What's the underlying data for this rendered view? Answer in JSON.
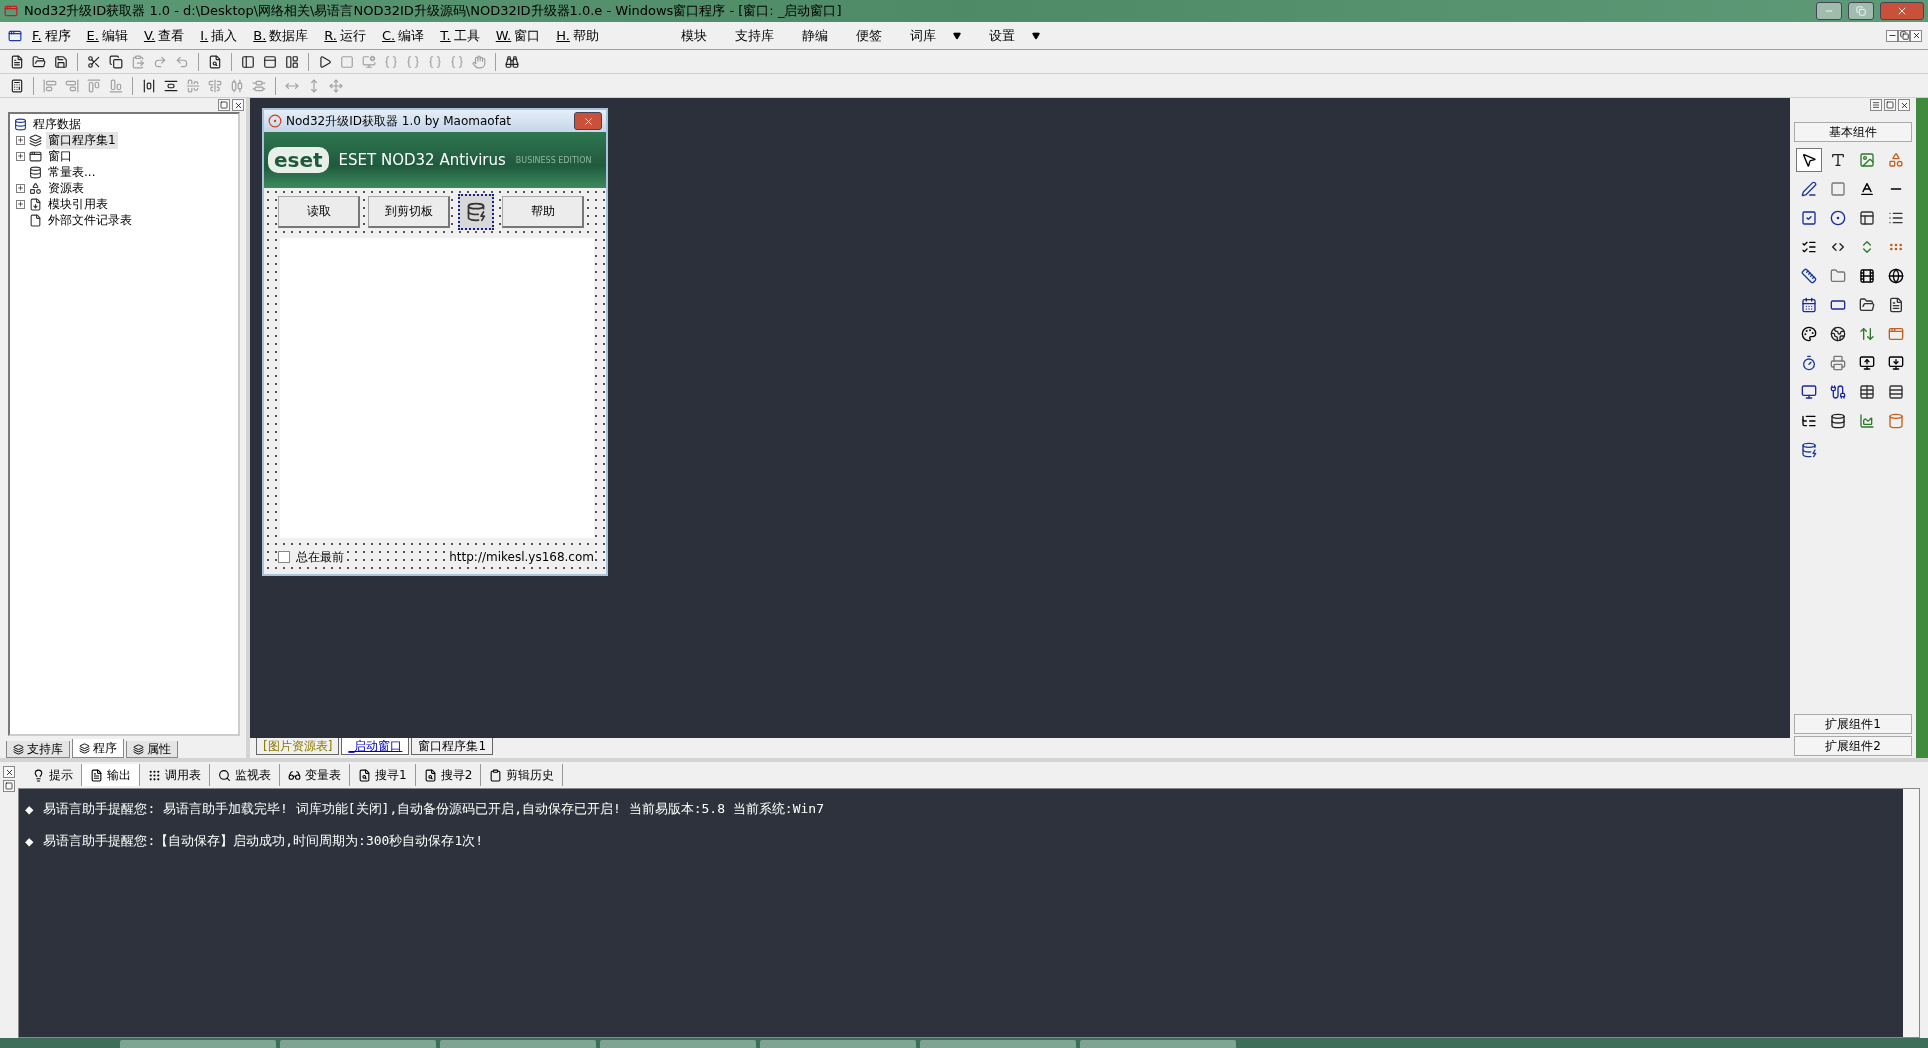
{
  "window": {
    "title": "Nod32升级ID获取器 1.0 - d:\\Desktop\\网络相关\\易语言NOD32ID升级源码\\NOD32ID升级器1.0.e - Windows窗口程序 - [窗口: _启动窗口]"
  },
  "menu": [
    {
      "key": "F.",
      "label": "程序"
    },
    {
      "key": "E.",
      "label": "编辑"
    },
    {
      "key": "V.",
      "label": "查看"
    },
    {
      "key": "I.",
      "label": "插入"
    },
    {
      "key": "B.",
      "label": "数据库"
    },
    {
      "key": "R.",
      "label": "运行"
    },
    {
      "key": "C.",
      "label": "编译"
    },
    {
      "key": "T.",
      "label": "工具"
    },
    {
      "key": "W.",
      "label": "窗口"
    },
    {
      "key": "H.",
      "label": "帮助"
    }
  ],
  "quick_menu": [
    {
      "label": "模块",
      "dropdown": false
    },
    {
      "label": "支持库",
      "dropdown": false
    },
    {
      "label": "静编",
      "dropdown": false
    },
    {
      "label": "便签",
      "dropdown": false
    },
    {
      "label": "词库",
      "dropdown": true
    },
    {
      "label": "设置",
      "dropdown": true
    }
  ],
  "project_tree": {
    "root": "程序数据",
    "items": [
      {
        "label": "窗口程序集1",
        "expandable": true,
        "selected": true,
        "kind": "stack"
      },
      {
        "label": "窗口",
        "expandable": true,
        "selected": false,
        "kind": "window"
      },
      {
        "label": "常量表...",
        "expandable": false,
        "selected": false,
        "kind": "db"
      },
      {
        "label": "资源表",
        "expandable": true,
        "selected": false,
        "kind": "res"
      },
      {
        "label": "模块引用表",
        "expandable": true,
        "selected": false,
        "kind": "module"
      },
      {
        "label": "外部文件记录表",
        "expandable": false,
        "selected": false,
        "kind": "file"
      }
    ]
  },
  "left_tabs": [
    {
      "label": "支持库",
      "selected": false
    },
    {
      "label": "程序",
      "selected": true
    },
    {
      "label": "属性",
      "selected": false
    }
  ],
  "form": {
    "title": "Nod32升级ID获取器 1.0 by Maomaofat",
    "logo": "eset",
    "product": "ESET NOD32 Antivirus",
    "edition": "BUSINESS EDITION",
    "buttons": [
      "读取",
      "到剪切板",
      "帮助"
    ],
    "checkbox": {
      "label": "总在最前",
      "checked": false
    },
    "link": "http://mikesl.ys168.com"
  },
  "designer_tabs": [
    {
      "label": "[图片资源表]",
      "selected": false
    },
    {
      "label": "_启动窗口",
      "selected": true
    },
    {
      "label": "窗口程序集1",
      "selected": false
    }
  ],
  "toolbox": {
    "title": "基本组件",
    "groups": [
      "扩展组件1",
      "扩展组件2"
    ]
  },
  "output_tabs": [
    {
      "label": "提示",
      "selected": false
    },
    {
      "label": "输出",
      "selected": true
    },
    {
      "label": "调用表",
      "selected": false
    },
    {
      "label": "监视表",
      "selected": false
    },
    {
      "label": "变量表",
      "selected": false
    },
    {
      "label": "搜寻1",
      "selected": false
    },
    {
      "label": "搜寻2",
      "selected": false
    },
    {
      "label": "剪辑历史",
      "selected": false
    }
  ],
  "output": [
    {
      "bullet": "◆",
      "text": "易语言助手提醒您:  易语言助手加载完毕!  词库功能[关闭],自动备份源码已开启,自动保存已开启!  当前易版本:5.8  当前系统:Win7"
    },
    {
      "bullet": "◆",
      "text": "易语言助手提醒您:【自动保存】启动成功,时间周期为:300秒自动保存1次!"
    }
  ]
}
